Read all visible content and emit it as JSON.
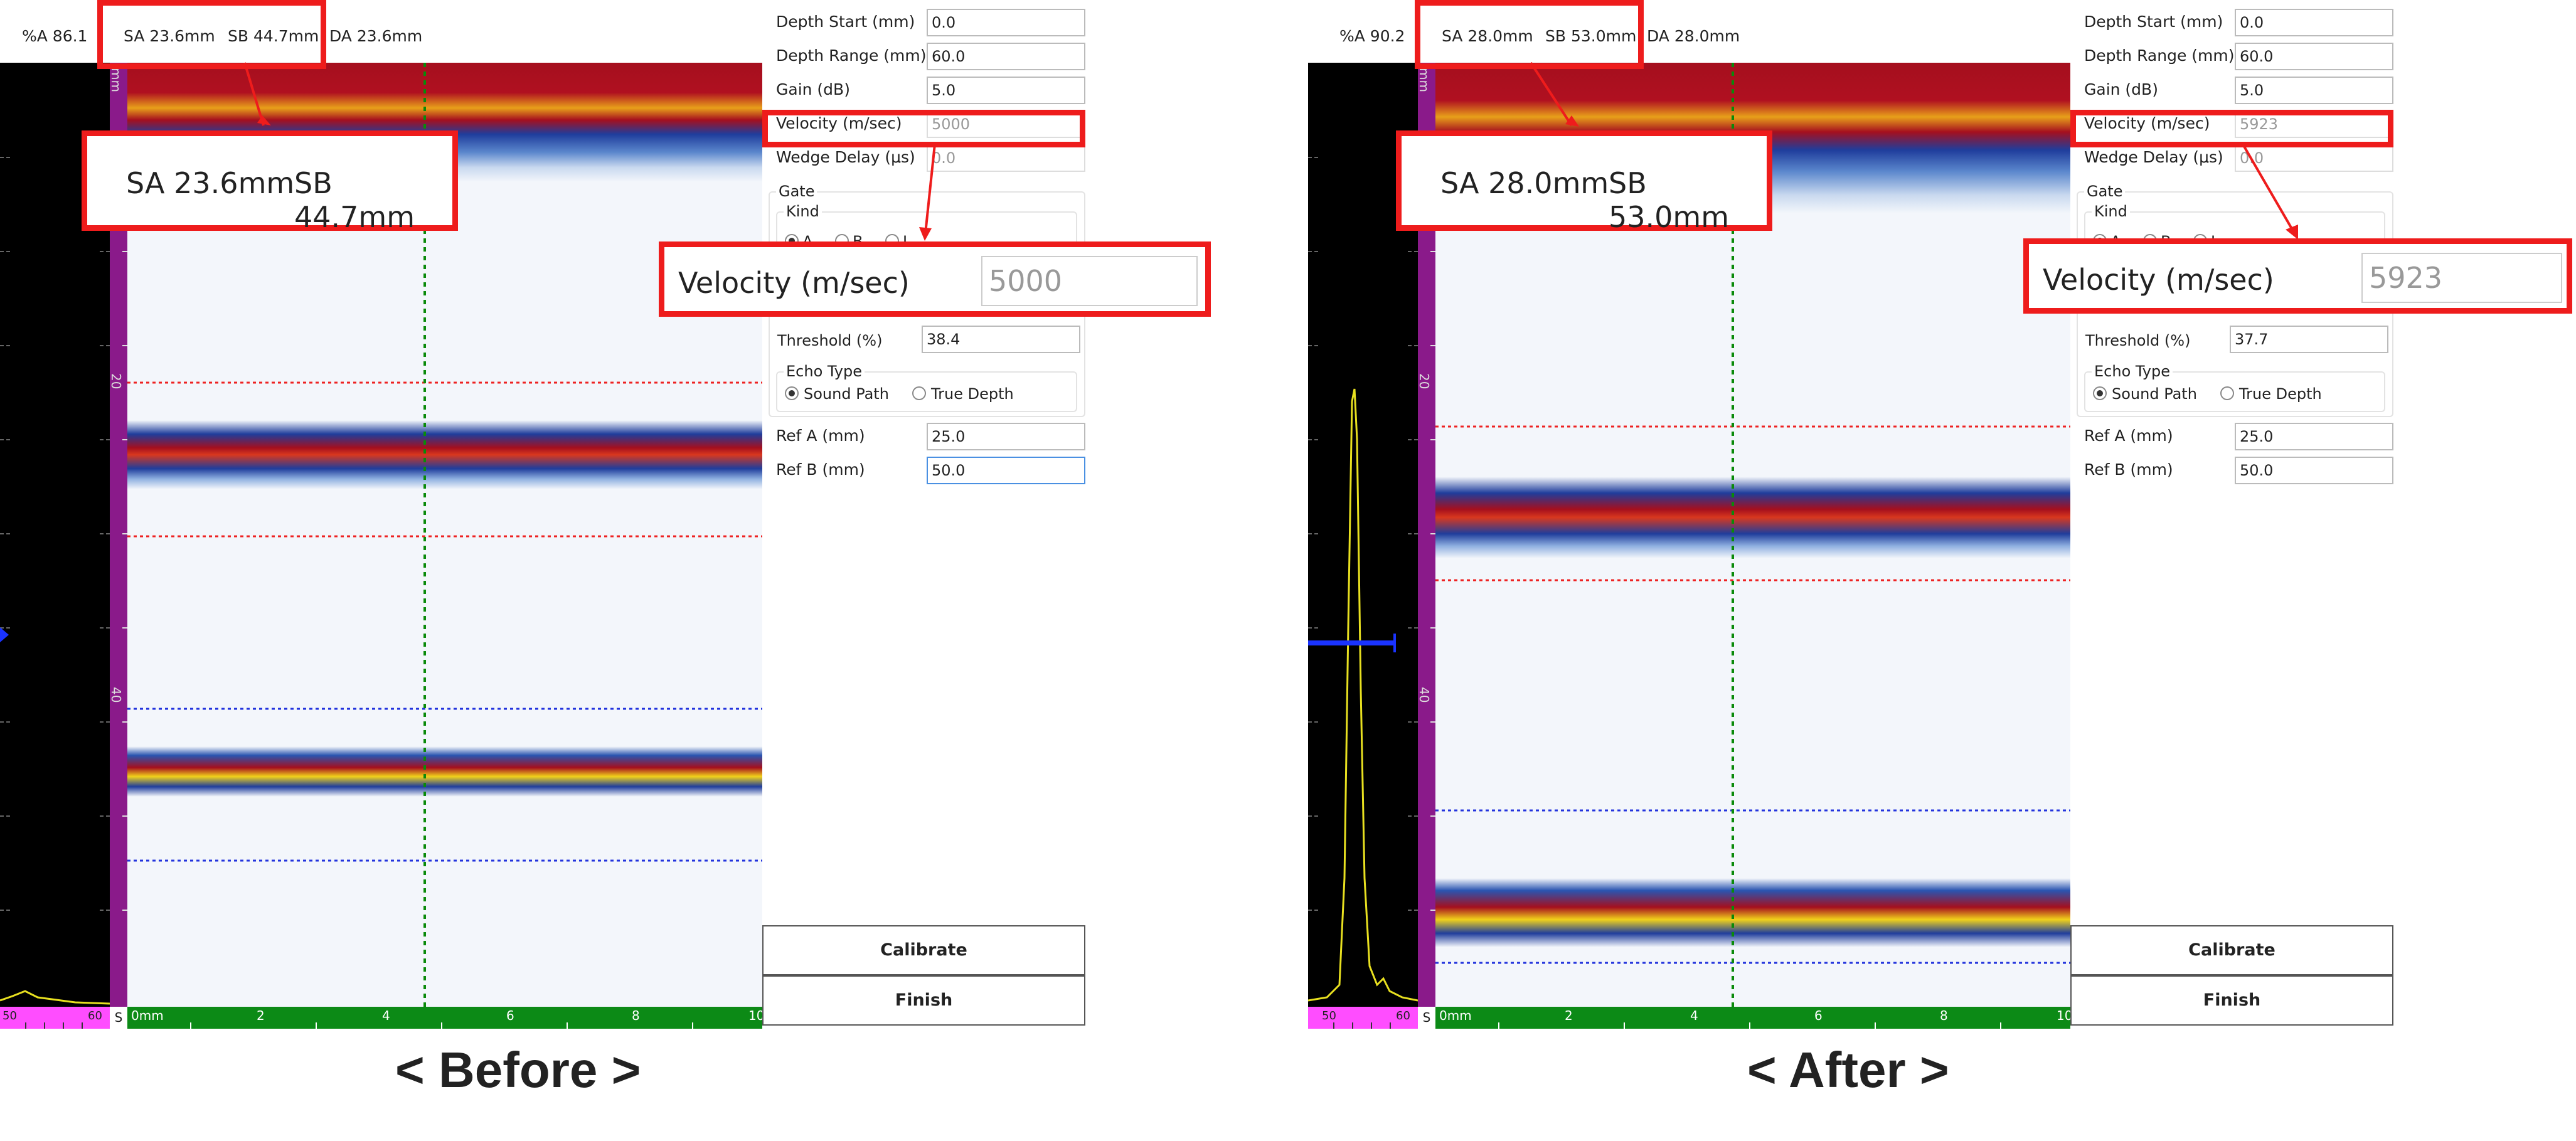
{
  "before": {
    "header": {
      "pct_a": "%A 86.1",
      "sa": "SA 23.6mm",
      "sb": "SB 44.7mm",
      "da": "DA 23.6mm"
    },
    "depth_axis": {
      "unit": "mm",
      "ticks": [
        "20",
        "40"
      ]
    },
    "ascan_ruler": [
      "50",
      "60"
    ],
    "s_label": "S",
    "x_ruler": [
      "0mm",
      "2",
      "4",
      "6",
      "8",
      "10"
    ],
    "settings": [
      {
        "label": "Depth Start (mm)",
        "value": "0.0"
      },
      {
        "label": "Depth Range (mm)",
        "value": "60.0"
      },
      {
        "label": "Gain (dB)",
        "value": "5.0"
      },
      {
        "label": "Velocity (m/sec)",
        "value": "5000"
      },
      {
        "label": "Wedge Delay (μs)",
        "value": "0.0"
      }
    ],
    "gate": {
      "title": "Gate",
      "kind_title": "Kind",
      "kinds": [
        "A",
        "B",
        "I"
      ],
      "threshold_label": "Threshold (%)",
      "threshold_value": "38.4",
      "echo_title": "Echo Type",
      "echo_options": [
        "Sound Path",
        "True Depth"
      ]
    },
    "refs": [
      {
        "label": "Ref A (mm)",
        "value": "25.0"
      },
      {
        "label": "Ref B (mm)",
        "value": "50.0"
      }
    ],
    "buttons": {
      "calibrate": "Calibrate",
      "finish": "Finish"
    },
    "zoom_sa": "SA 23.6mm",
    "zoom_sb": "SB 44.7mm",
    "zoom_velocity_label": "Velocity (m/sec)",
    "zoom_velocity_value": "5000",
    "caption": "< Before >"
  },
  "after": {
    "header": {
      "pct_a": "%A 90.2",
      "sa": "SA 28.0mm",
      "sb": "SB 53.0mm",
      "da": "DA 28.0mm"
    },
    "depth_axis": {
      "unit": "mm",
      "ticks": [
        "20",
        "40"
      ]
    },
    "ascan_ruler": [
      "50",
      "60"
    ],
    "s_label": "S",
    "x_ruler": [
      "0mm",
      "2",
      "4",
      "6",
      "8",
      "10"
    ],
    "settings": [
      {
        "label": "Depth Start (mm)",
        "value": "0.0"
      },
      {
        "label": "Depth Range (mm)",
        "value": "60.0"
      },
      {
        "label": "Gain (dB)",
        "value": "5.0"
      },
      {
        "label": "Velocity (m/sec)",
        "value": "5923"
      },
      {
        "label": "Wedge Delay (μs)",
        "value": "0.0"
      }
    ],
    "gate": {
      "title": "Gate",
      "kind_title": "Kind",
      "kinds": [
        "A",
        "B",
        "I"
      ],
      "threshold_label": "Threshold (%)",
      "threshold_value": "37.7",
      "echo_title": "Echo Type",
      "echo_options": [
        "Sound Path",
        "True Depth"
      ]
    },
    "refs": [
      {
        "label": "Ref A (mm)",
        "value": "25.0"
      },
      {
        "label": "Ref B (mm)",
        "value": "50.0"
      }
    ],
    "buttons": {
      "calibrate": "Calibrate",
      "finish": "Finish"
    },
    "zoom_sa": "SA 28.0mm",
    "zoom_sb": "SB 53.0mm",
    "zoom_velocity_label": "Velocity (m/sec)",
    "zoom_velocity_value": "5923",
    "caption": "< After >"
  },
  "colors": {
    "highlight": "#ee1c1c",
    "echo_core": "#a50f1e",
    "echo_mid": "#f2d21a",
    "echo_edge": "#1f3d9c",
    "gate_a": "#ee2222",
    "gate_b": "#2233dd",
    "cursor": "#0a8a0a",
    "ascan_trace": "#e8e020"
  }
}
